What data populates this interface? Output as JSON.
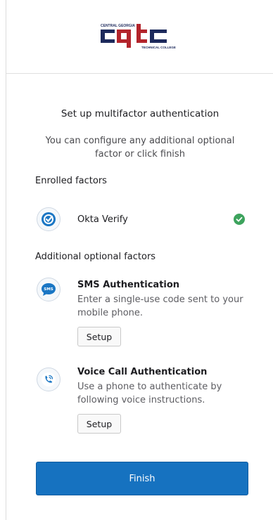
{
  "logo": {
    "top_text": "CENTRAL GEORGIA",
    "letters": "cgtc",
    "bottom_text": "TECHNICAL COLLEGE",
    "colors": {
      "navy": "#1d2a5c",
      "red": "#b3242b"
    }
  },
  "heading": "Set up multifactor authentication",
  "subtitle": "You can configure any additional optional factor or click finish",
  "enrolled": {
    "title": "Enrolled factors",
    "factors": [
      {
        "name": "Okta Verify",
        "icon": "okta-verify-icon",
        "status": "enrolled-check-icon",
        "status_color": "#3da35d"
      }
    ]
  },
  "optional": {
    "title": "Additional optional factors",
    "factors": [
      {
        "name": "SMS Authentication",
        "description": "Enter a single-use code sent to your mobile phone.",
        "icon": "sms-icon",
        "icon_text": "SMS",
        "button": "Setup"
      },
      {
        "name": "Voice Call Authentication",
        "description": "Use a phone to authenticate by following voice instructions.",
        "icon": "voice-call-icon",
        "button": "Setup"
      }
    ]
  },
  "finish_button": "Finish",
  "colors": {
    "primary": "#1672c0",
    "icon_blue": "#1a76c4"
  }
}
